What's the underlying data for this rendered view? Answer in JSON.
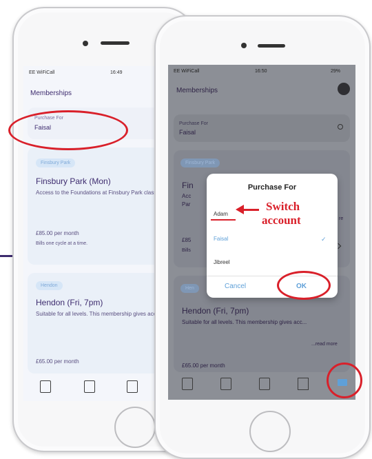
{
  "back_phone": {
    "status": {
      "carrier": "EE WiFiCall",
      "time": "16:49"
    },
    "header_title": "Memberships",
    "purchase_for": {
      "label": "Purchase For",
      "value": "Faisal"
    },
    "cards": [
      {
        "tag": "Finsbury Park",
        "title": "Finsbury Park (Mon)",
        "desc": "Access to the Foundations at Finsbury Park class. ...",
        "price": "£85.00 per month",
        "note": "Bills one cycle at a time."
      },
      {
        "tag": "Hendon",
        "title": "Hendon (Fri, 7pm)",
        "desc": "Suitable for all levels. This membership gives acc...",
        "price": "£65.00 per month"
      }
    ]
  },
  "front_phone": {
    "status": {
      "carrier": "EE WiFiCall",
      "time": "16:50",
      "battery": "29%"
    },
    "header_title": "Memberships",
    "purchase_for": {
      "label": "Purchase For",
      "value": "Faisal"
    },
    "card1": {
      "tag": "Finsbury Park",
      "title_fragment": "Fin",
      "desc_fragment_1": "Acc",
      "desc_fragment_2": "Par",
      "more_fragment": "re",
      "price_fragment": "£85",
      "note_fragment": "Bills"
    },
    "card2": {
      "tag_fragment": "Hen",
      "title": "Hendon (Fri, 7pm)",
      "desc": "Suitable for all levels. This membership gives acc...",
      "read_more": "...read more",
      "price": "£65.00 per month"
    },
    "dialog": {
      "title": "Purchase For",
      "options": [
        "Adam",
        "Faisal",
        "Jibreel"
      ],
      "selected": "Faisal",
      "cancel": "Cancel",
      "ok": "OK"
    }
  },
  "annotation": {
    "line1": "Switch",
    "line2": "account",
    "color": "#d9202a"
  },
  "colors": {
    "accent": "#3d2b6e",
    "blue": "#5fa0d8",
    "highlight": "#d9202a"
  }
}
